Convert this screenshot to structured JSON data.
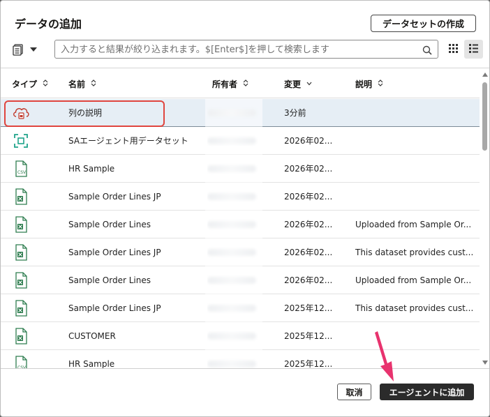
{
  "dialog": {
    "title": "データの追加",
    "create_dataset_label": "データセットの作成"
  },
  "search": {
    "placeholder": "入力すると結果が絞り込まれます。$[Enter$]を押して検索します",
    "value": ""
  },
  "columns": {
    "type": "タイプ",
    "name": "名前",
    "owner": "所有者",
    "modified": "変更",
    "description": "説明"
  },
  "rows": [
    {
      "icon": "cloud-dataset-icon",
      "name": "列の説明",
      "modified": "3分前",
      "description": ""
    },
    {
      "icon": "subject-area-icon",
      "name": "SAエージェント用データセット",
      "modified": "2026年02...",
      "description": ""
    },
    {
      "icon": "csv-file-icon",
      "name": "HR Sample",
      "modified": "2026年02...",
      "description": ""
    },
    {
      "icon": "excel-file-icon",
      "name": "Sample Order Lines JP",
      "modified": "2026年02...",
      "description": ""
    },
    {
      "icon": "excel-file-icon",
      "name": "Sample Order Lines",
      "modified": "2026年02...",
      "description": "Uploaded from Sample Or..."
    },
    {
      "icon": "excel-file-icon",
      "name": "Sample Order Lines JP",
      "modified": "2026年02...",
      "description": "This dataset provides cust..."
    },
    {
      "icon": "excel-file-icon",
      "name": "Sample Order Lines",
      "modified": "2026年02...",
      "description": "Uploaded from Sample Or..."
    },
    {
      "icon": "excel-file-icon",
      "name": "Sample Order Lines JP",
      "modified": "2025年12...",
      "description": "This dataset provides cust..."
    },
    {
      "icon": "excel-file-icon",
      "name": "CUSTOMER",
      "modified": "2025年12...",
      "description": ""
    },
    {
      "icon": "csv-file-icon",
      "name": "HR Sample",
      "modified": "2025年12...",
      "description": ""
    }
  ],
  "footer": {
    "cancel_label": "取消",
    "add_label": "エージェントに追加"
  },
  "colors": {
    "highlight": "#e0453e",
    "arrow": "#e8336e",
    "selected_row": "#e6eef5",
    "primary_button": "#2b2b2b"
  }
}
